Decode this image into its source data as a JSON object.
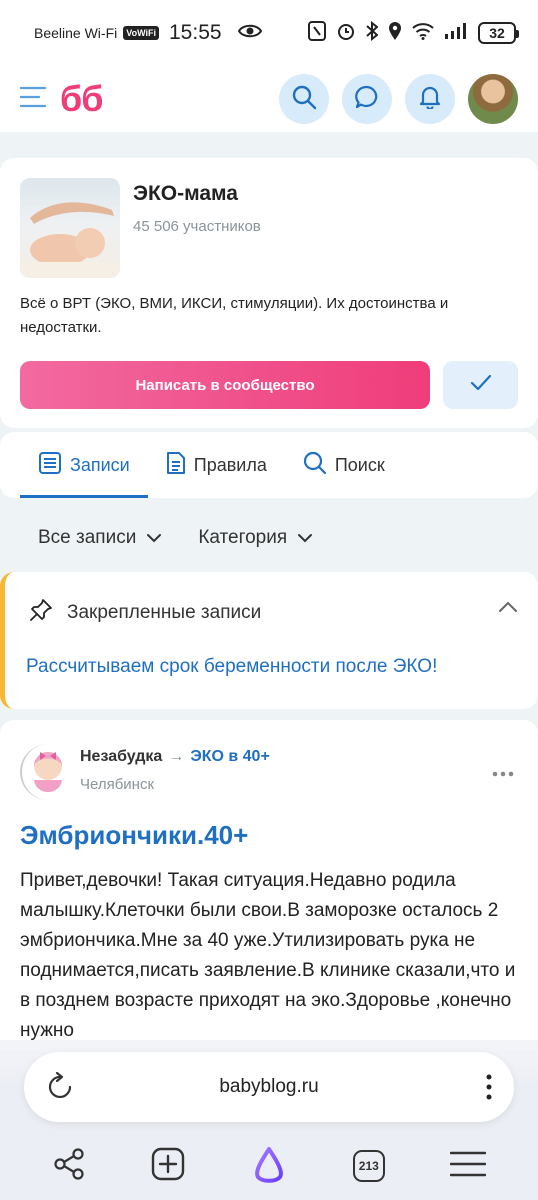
{
  "status_bar": {
    "carrier": "Beeline Wi-Fi",
    "wifi_badge": "VoWiFi",
    "time": "15:55",
    "battery": "32"
  },
  "header": {
    "logo": "бб",
    "icons": [
      "menu-icon",
      "search-icon",
      "chat-icon",
      "bell-icon",
      "avatar"
    ]
  },
  "community": {
    "title": "ЭКО-мама",
    "members": "45 506 участников",
    "description": "Всё о ВРТ (ЭКО, ВМИ, ИКСИ, стимуляции). Их достоинства и недостатки.",
    "write_button": "Написать в сообщество",
    "joined_icon": "check-icon"
  },
  "tabs": [
    {
      "label": "Записи",
      "icon": "list-icon",
      "active": true
    },
    {
      "label": "Правила",
      "icon": "document-icon",
      "active": false
    },
    {
      "label": "Поиск",
      "icon": "search-icon",
      "active": false
    }
  ],
  "filters": {
    "all_posts": "Все записи",
    "category": "Категория"
  },
  "pinned": {
    "heading": "Закрепленные записи",
    "link": "Рассчитываем срок беременности после ЭКО!"
  },
  "post": {
    "author": "Незабудка",
    "arrow": "→",
    "community": "ЭКО в 40+",
    "city": "Челябинск",
    "title": "Эмбриончики.40+",
    "body": "Привет,девочки! Такая ситуация.Недавно родила малышку.Клеточки были свои.В заморозке осталось 2 эмбриончика.Мне за 40 уже.Утилизировать рука не поднимается,писать заявление.В клинике сказали,что и в позднем возрасте приходят на эко.Здоровье ,конечно нужно"
  },
  "browser": {
    "url": "babyblog.ru",
    "tab_count": "213"
  },
  "colors": {
    "brand_pink": "#ef3d7a",
    "link_blue": "#1f6fc2",
    "pinned_accent": "#f7b733",
    "icon_bg": "#d8ebfa"
  }
}
